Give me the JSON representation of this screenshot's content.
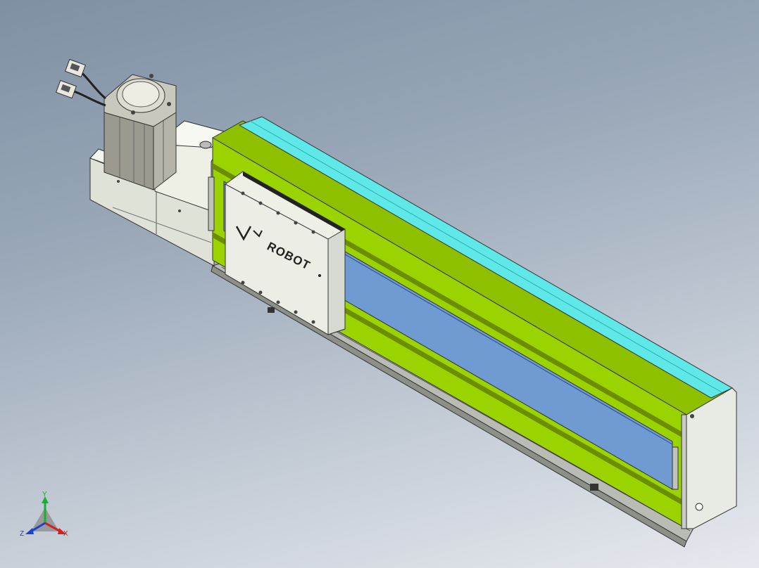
{
  "model": {
    "logo_text": "ROBOT",
    "colors": {
      "background_top": "#7f90a4",
      "background_bottom": "#e6e9ee",
      "profile_green": "#9bd300",
      "profile_cyan": "#5fe8e8",
      "belt_cover_blue": "#6f9bd2",
      "housing_white": "#eef0e6"
    }
  },
  "triad": {
    "x_label": "X",
    "y_label": "Y",
    "z_label": "Z",
    "x_color": "#d42020",
    "y_color": "#18b030",
    "z_color": "#2040d0"
  }
}
